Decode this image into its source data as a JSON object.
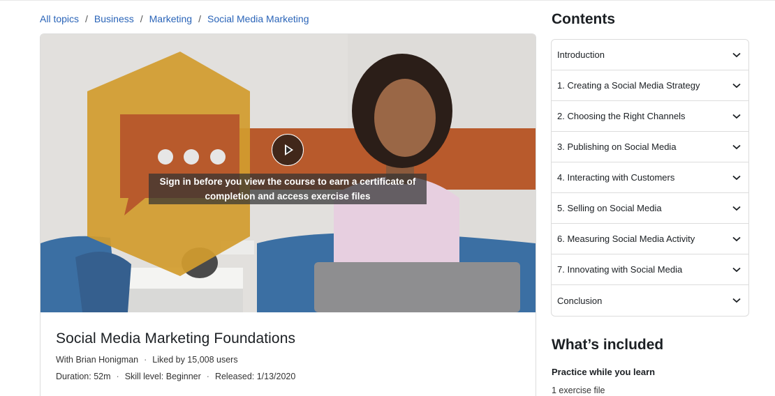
{
  "breadcrumb": {
    "items": [
      "All topics",
      "Business",
      "Marketing",
      "Social Media Marketing"
    ],
    "separator": "/"
  },
  "video": {
    "signin_line1": "Sign in before you view the course to earn a certificate of",
    "signin_line2": "completion and access exercise files",
    "play_icon": "play-icon"
  },
  "course": {
    "title": "Social Media Marketing Foundations",
    "author": "With Brian Honigman",
    "likes": "Liked by 15,008 users",
    "duration": "Duration: 52m",
    "skill_level": "Skill level: Beginner",
    "released": "Released: 1/13/2020",
    "dot": "·"
  },
  "contents": {
    "heading": "Contents",
    "items": [
      "Introduction",
      "1. Creating a Social Media Strategy",
      "2. Choosing the Right Channels",
      "3. Publishing on Social Media",
      "4. Interacting with Customers",
      "5. Selling on Social Media",
      "6. Measuring Social Media Activity",
      "7. Innovating with Social Media",
      "Conclusion"
    ],
    "chevron_icon": "chevron-down-icon"
  },
  "included": {
    "heading": "What’s included",
    "practice": "Practice while you learn",
    "exercise": "1 exercise file"
  },
  "colors": {
    "link": "#2a64b8",
    "hexagon": "#d29c2e",
    "accent_band": "#b85a2c",
    "chair": "#3b6fa3"
  }
}
